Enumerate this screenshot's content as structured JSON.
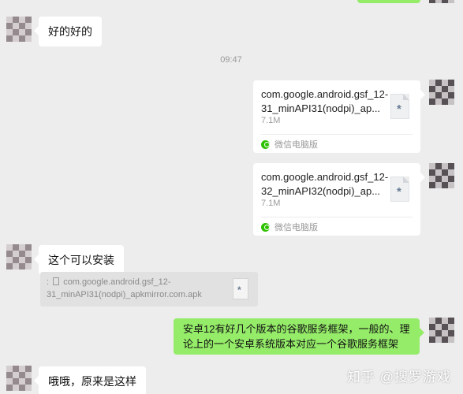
{
  "messages": {
    "m1": {
      "text": "好的好的"
    },
    "timestamp": "09:47",
    "file1": {
      "name": "com.google.android.gsf_12-31_minAPI31(nodpi)_ap...",
      "size": "7.1M",
      "source": "微信电脑版"
    },
    "file2": {
      "name": "com.google.android.gsf_12-32_minAPI32(nodpi)_ap...",
      "size": "7.1M",
      "source": "微信电脑版"
    },
    "m2": {
      "text": "这个可以安装"
    },
    "quote": {
      "prefix": ":",
      "text": "com.google.android.gsf_12-31_minAPI31(nodpi)_apkmirror.com.apk"
    },
    "m3": {
      "text": "安卓12有好几个版本的谷歌服务框架，一般的、理论上的一个安卓系统版本对应一个谷歌服务框架"
    },
    "m4": {
      "text": "哦哦，原来是这样"
    }
  },
  "watermark": {
    "text": "知乎 @搜罗游戏"
  },
  "colors": {
    "background": "#ededed",
    "bubble_self": "#95ec69",
    "bubble_other": "#ffffff"
  },
  "icons": [
    "document-icon",
    "wechat-pc-icon",
    "avatar"
  ]
}
